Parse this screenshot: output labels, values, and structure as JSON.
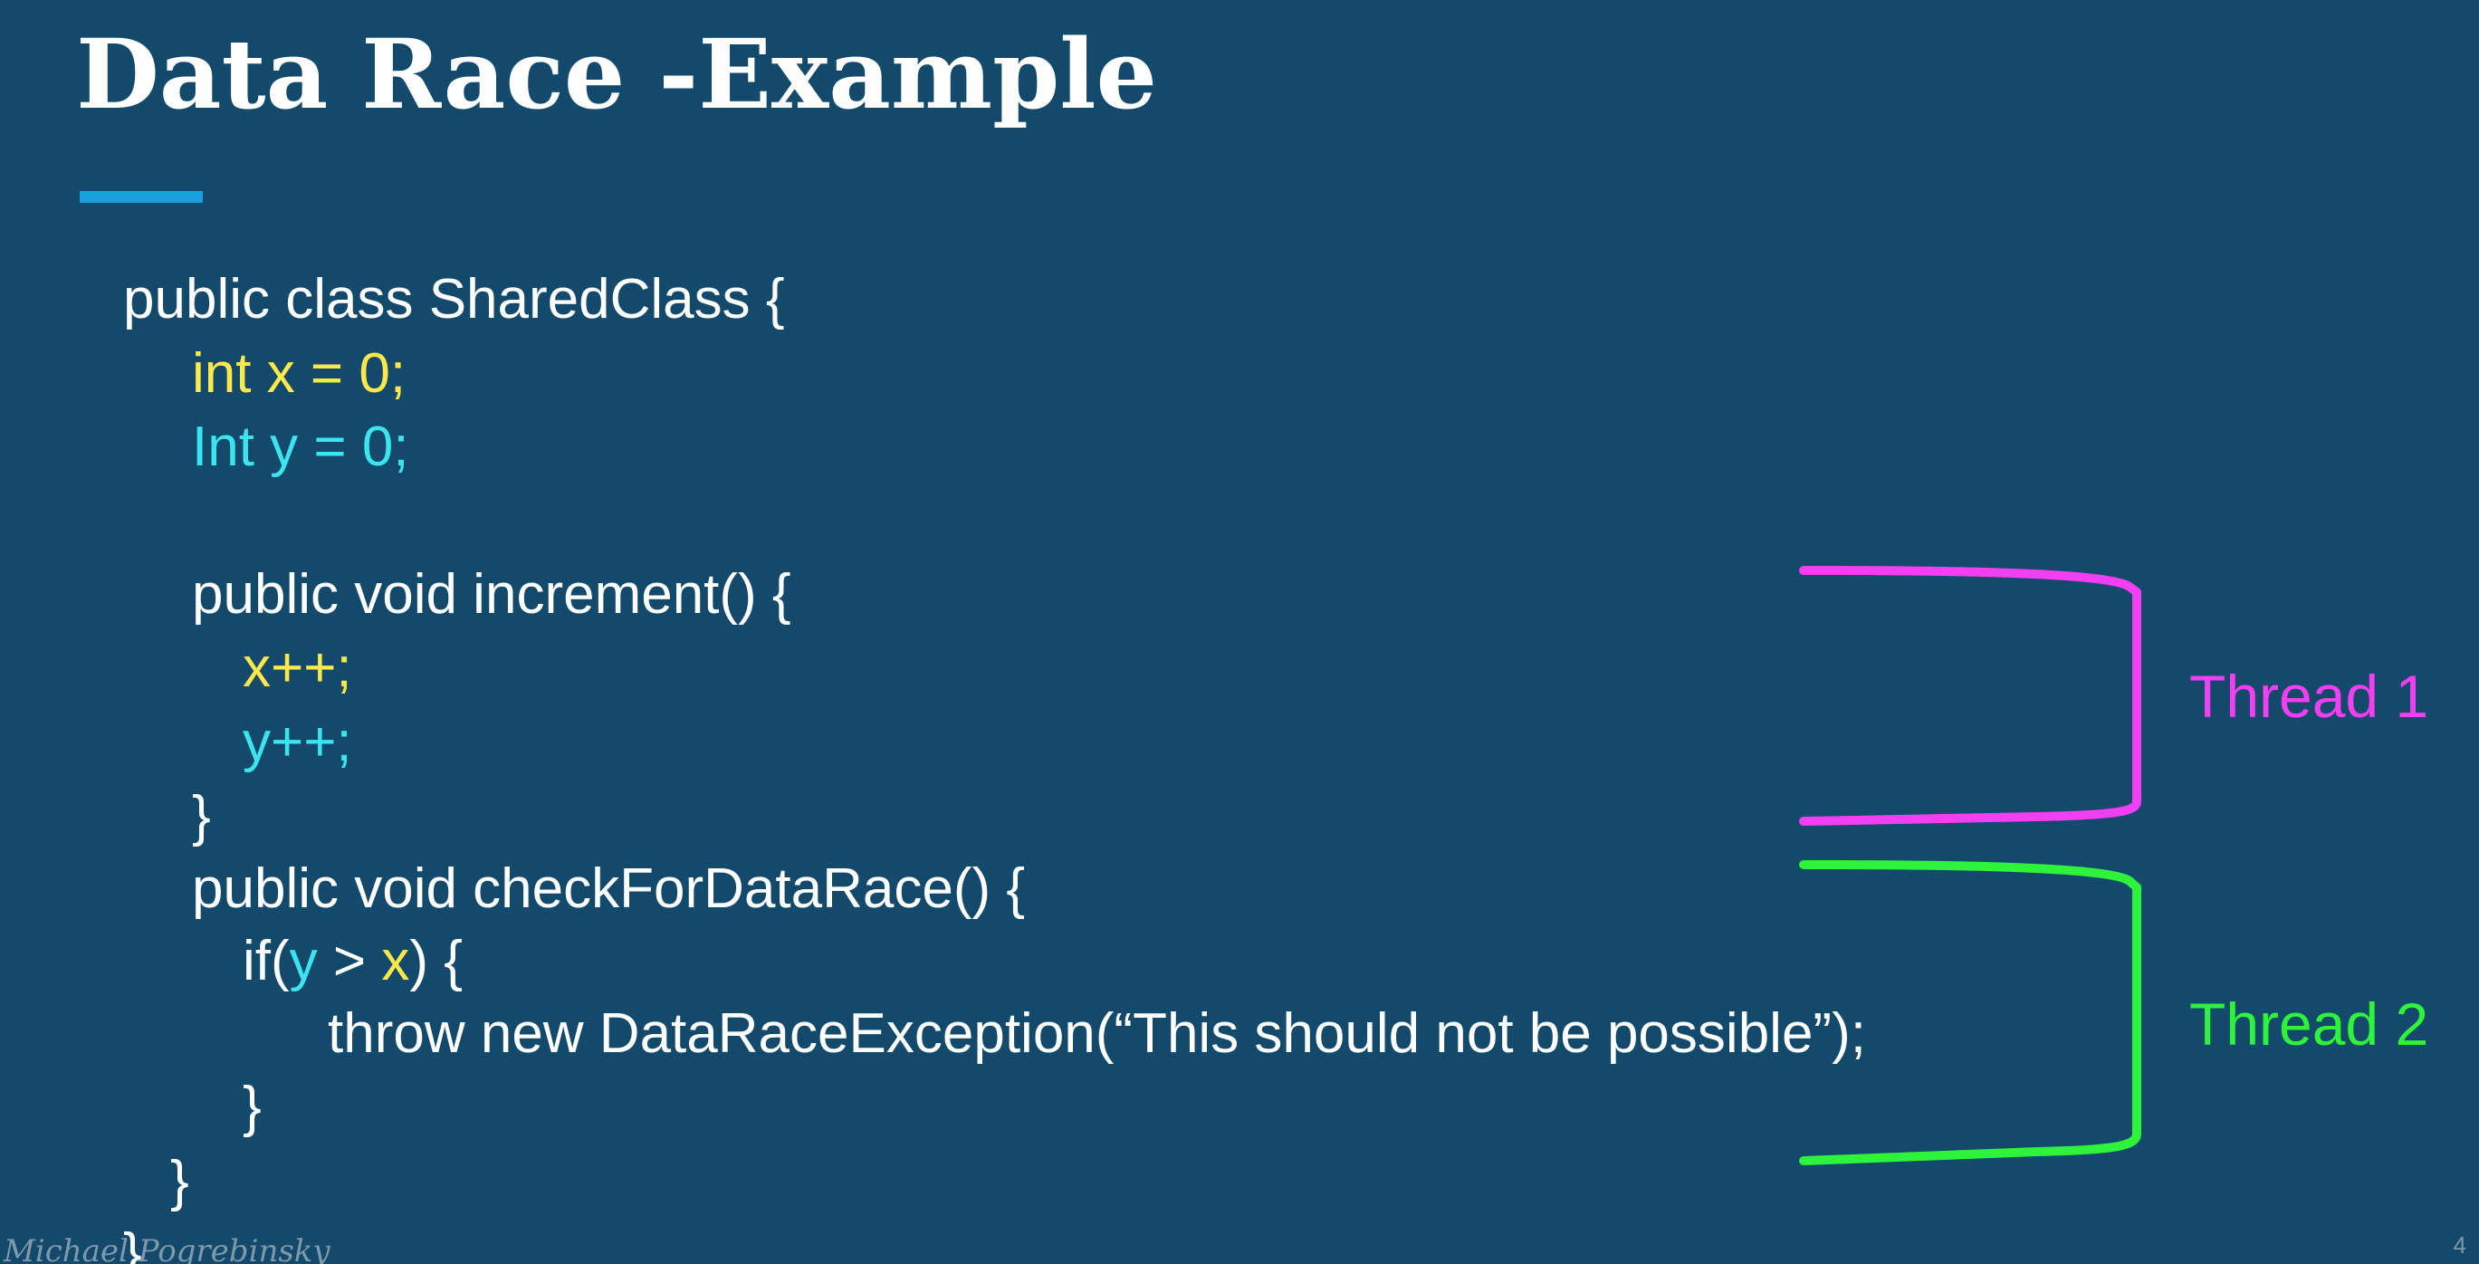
{
  "slide": {
    "title": "Data Race -Example",
    "author": "Michael Pogrebinsky",
    "page_number": "4"
  },
  "code": {
    "line1": "public class SharedClass {",
    "line2": "int x = 0;",
    "line3": "Int y = 0;",
    "line4": "public void increment() {",
    "line5": "x++;",
    "line6": "y++;",
    "line7": "}",
    "line8": "public void checkForDataRace() {",
    "line9_prefix": "if(",
    "line9_y": "y",
    "line9_mid": " > ",
    "line9_x": "x",
    "line9_suffix": ") {",
    "line10": "throw new DataRaceException(“This should not be possible”);",
    "line11": "}",
    "line12": "}",
    "line13": "}"
  },
  "threads": [
    {
      "label": "Thread 1",
      "color": "#f23ff2"
    },
    {
      "label": "Thread 2",
      "color": "#2ff23a"
    }
  ],
  "colors": {
    "background": "#134a6b",
    "accent": "#1aa0dc",
    "x_var": "#ffe94a",
    "y_var": "#3be4ee"
  }
}
